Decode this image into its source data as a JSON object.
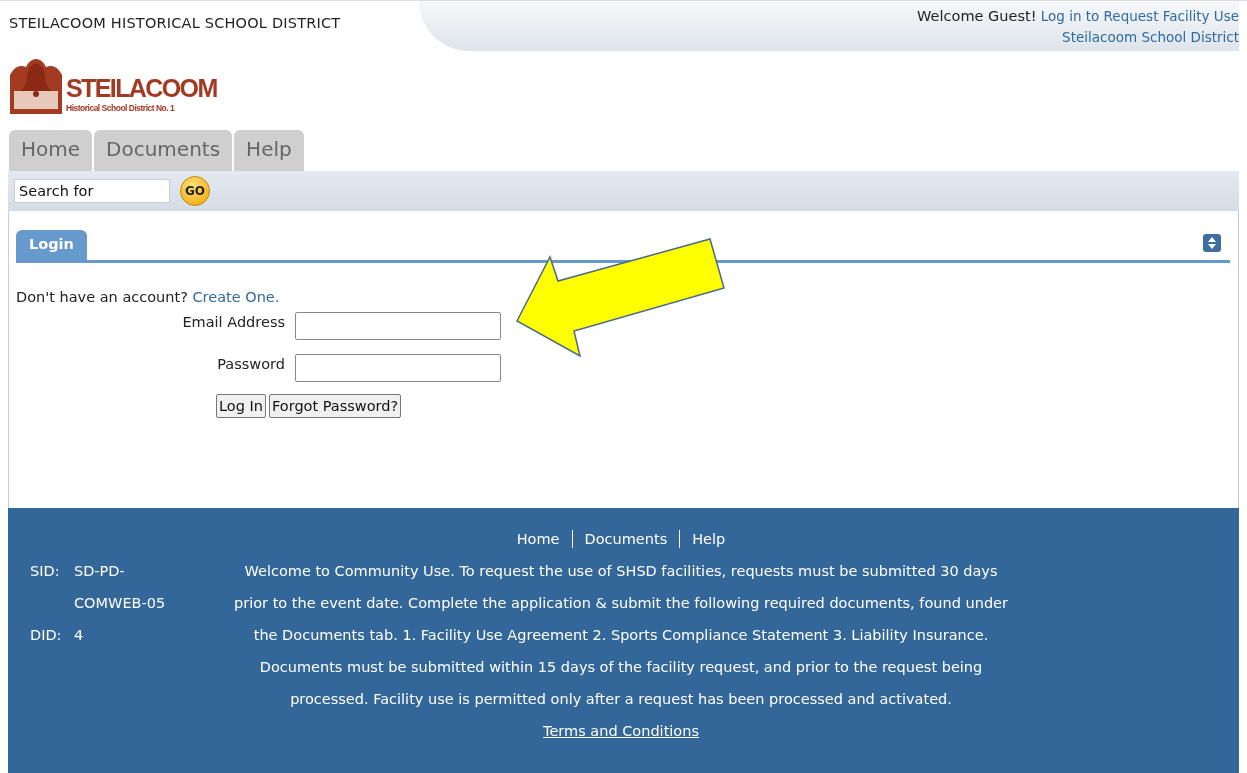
{
  "header": {
    "site_title": "STEILACOOM HISTORICAL SCHOOL DISTRICT",
    "welcome": "Welcome Guest!",
    "login_link": "Log in to Request Facility Use",
    "district_link": "Steilacoom School District"
  },
  "logo": {
    "name": "STEILACOOM",
    "subtitle": "Historical School District No. 1"
  },
  "tabs": [
    {
      "label": "Home",
      "selected": false
    },
    {
      "label": "Documents",
      "selected": false
    },
    {
      "label": "Help",
      "selected": false
    }
  ],
  "search": {
    "placeholder": "Search for",
    "button": "GO"
  },
  "panel": {
    "tab": "Login",
    "no_account": "Don't have an account?",
    "create_link": "Create One.",
    "fields": [
      {
        "label": "Email Address"
      },
      {
        "label": "Password"
      }
    ],
    "buttons": [
      "Log In",
      "Forgot Password?"
    ]
  },
  "footer": {
    "links": [
      "Home",
      "Documents",
      "Help"
    ],
    "ids": [
      {
        "label": "SID:",
        "value": "SD-PD-COMWEB-05"
      },
      {
        "label": "DID:",
        "value": "4"
      }
    ],
    "text": "Welcome to Community Use. To request the use of SHSD facilities, requests must be submitted 30 days prior to the event date. Complete the application & submit the following required documents, found under the Documents tab. 1. Facility Use Agreement 2. Sports Compliance Statement 3. Liability Insurance. Documents must be submitted within 15 days of the facility request, and prior to the request being processed. Facility use is permitted only after a request has been processed and activated.",
    "terms": "Terms and Conditions"
  }
}
